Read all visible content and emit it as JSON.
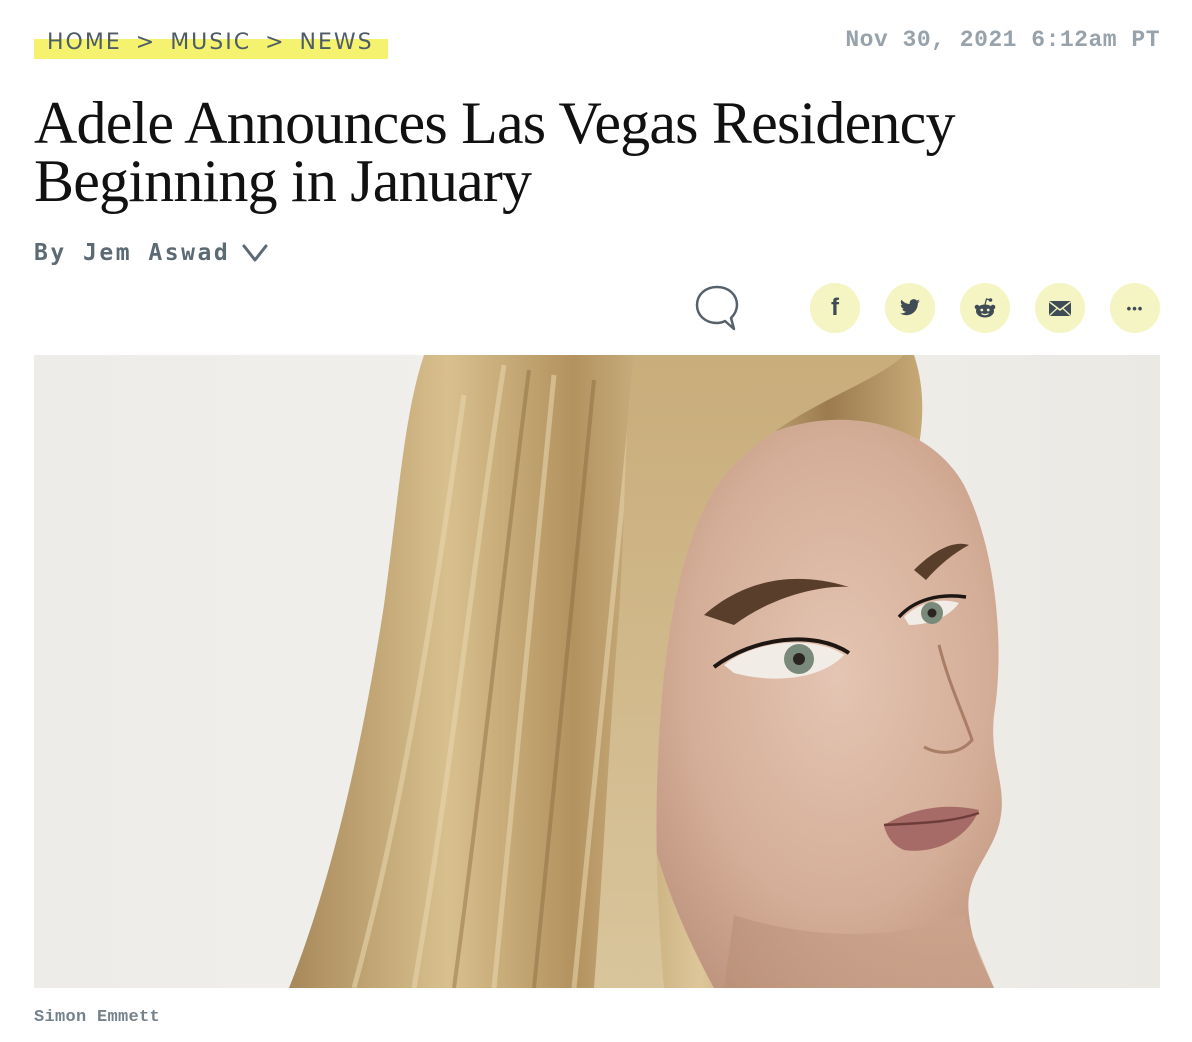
{
  "breadcrumb": {
    "items": [
      "HOME",
      "MUSIC",
      "NEWS"
    ],
    "separator": ">"
  },
  "article": {
    "date": "Nov 30, 2021 6:12am PT",
    "headline_line1": "Adele Announces Las Vegas Residency",
    "headline_line2": "Beginning in January",
    "byline": "By Jem Aswad",
    "photo_credit": "Simon Emmett"
  },
  "share": {
    "icons": [
      "comment-icon",
      "facebook-icon",
      "twitter-icon",
      "reddit-icon",
      "email-icon",
      "more-icon"
    ],
    "facebook_glyph": "f",
    "more_glyph": "•••",
    "button_color": "#f4f5c2"
  },
  "colors": {
    "highlight": "#f4f26e",
    "headline": "#111111",
    "meta_text": "#97a2ab",
    "byline": "#5c6a74"
  }
}
